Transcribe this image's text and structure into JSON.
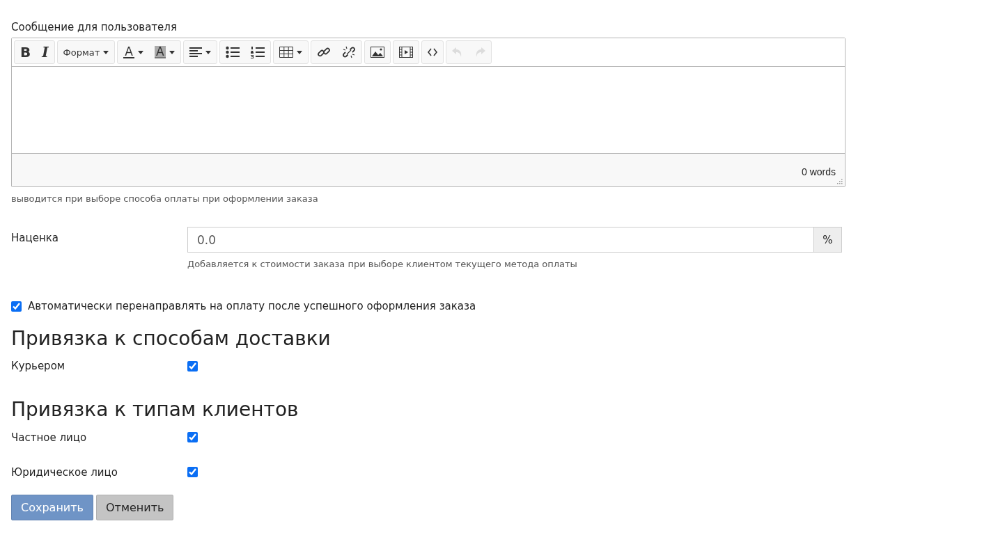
{
  "editor": {
    "label": "Сообщение для пользователя",
    "toolbar": [
      {
        "items": [
          {
            "kind": "bold",
            "label": "B",
            "disabled": false
          },
          {
            "kind": "italic",
            "label": "I",
            "disabled": false
          }
        ]
      },
      {
        "items": [
          {
            "kind": "format",
            "label": "Формат",
            "disabled": false
          }
        ]
      },
      {
        "items": [
          {
            "kind": "text-color",
            "label": "A",
            "disabled": false
          },
          {
            "kind": "back-color",
            "label": "A",
            "disabled": false
          }
        ]
      },
      {
        "items": [
          {
            "kind": "align",
            "disabled": false
          }
        ]
      },
      {
        "items": [
          {
            "kind": "bullet-list",
            "disabled": false
          },
          {
            "kind": "number-list",
            "disabled": false
          }
        ]
      },
      {
        "items": [
          {
            "kind": "table",
            "disabled": false
          }
        ]
      },
      {
        "items": [
          {
            "kind": "link",
            "disabled": false
          },
          {
            "kind": "unlink",
            "disabled": false
          }
        ]
      },
      {
        "items": [
          {
            "kind": "image",
            "disabled": false
          }
        ]
      },
      {
        "items": [
          {
            "kind": "media",
            "disabled": false
          }
        ]
      },
      {
        "items": [
          {
            "kind": "code",
            "disabled": false
          }
        ]
      },
      {
        "items": [
          {
            "kind": "undo",
            "disabled": true
          },
          {
            "kind": "redo",
            "disabled": true
          }
        ]
      }
    ],
    "word_count": "0 words",
    "help": "выводится при выборе способа оплаты при оформлении заказа"
  },
  "markup": {
    "label": "Наценка",
    "value": "0.0",
    "addon": "%",
    "help": "Добавляется к стоимости заказа при выборе клиентом текущего метода оплаты"
  },
  "auto_redirect": {
    "label": "Автоматически перенаправлять на оплату после успешного оформления заказа",
    "checked": true
  },
  "sections": [
    {
      "title": "Привязка к способам доставки",
      "rows": [
        {
          "label": "Курьером",
          "checked": true
        }
      ]
    },
    {
      "title": "Привязка к типам клиентов",
      "rows": [
        {
          "label": "Частное лицо",
          "checked": true
        },
        {
          "label": "Юридическое лицо",
          "checked": true
        }
      ]
    }
  ],
  "buttons": [
    {
      "kind": "primary",
      "label": "Сохранить"
    },
    {
      "kind": "secondary",
      "label": "Отменить"
    }
  ]
}
